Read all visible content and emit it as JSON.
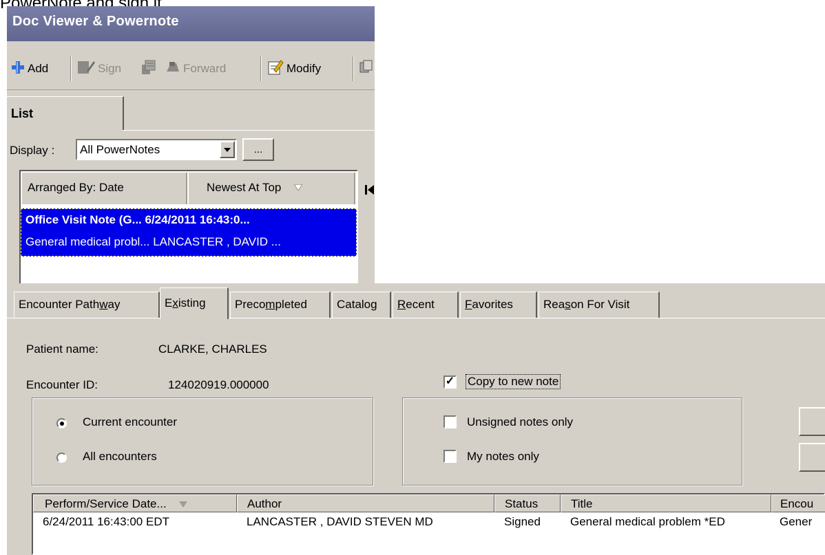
{
  "caption": "PowerNote and sign it.",
  "panel": {
    "title": "Doc Viewer & Powernote"
  },
  "toolbar": {
    "add": "Add",
    "sign": "Sign",
    "forward": "Forward",
    "modify": "Modify"
  },
  "list": {
    "tab_label": "List",
    "display_label": "Display :",
    "display_value": "All PowerNotes",
    "ellipsis": "...",
    "header_arranged": "Arranged By: Date",
    "header_order": "Newest At Top",
    "row_line1": "Office Visit Note (G...  6/24/2011 16:43:0...",
    "row_line2": "General medical probl... LANCASTER , DAVID ..."
  },
  "tabs": [
    {
      "label_pre": "Encounter Path",
      "key": "w",
      "label_post": "ay"
    },
    {
      "label_pre": "E",
      "key": "x",
      "label_post": "isting"
    },
    {
      "label_pre": "Preco",
      "key": "m",
      "label_post": "pleted"
    },
    {
      "label_pre": "Catalo",
      "key": "g",
      "label_post": ""
    },
    {
      "label_pre": "",
      "key": "R",
      "label_post": "ecent"
    },
    {
      "label_pre": "",
      "key": "F",
      "label_post": "avorites"
    },
    {
      "label_pre": "Rea",
      "key": "s",
      "label_post": "on For Visit"
    }
  ],
  "existing": {
    "patient_label": "Patient name:",
    "patient_value": "CLARKE, CHARLES",
    "encounter_label": "Encounter ID:",
    "encounter_value": "124020919.000000",
    "copy_to_new_note": "Copy to new note",
    "copy_checked": true,
    "current_encounter": "Current encounter",
    "all_encounters": "All encounters",
    "unsigned_only": "Unsigned notes only",
    "my_notes_only": "My notes only"
  },
  "notes_table": {
    "columns": [
      "Perform/Service Date...",
      "Author",
      "Status",
      "Title",
      "Encou"
    ],
    "rows": [
      [
        "6/24/2011 16:43:00 EDT",
        "LANCASTER , DAVID STEVEN MD",
        "Signed",
        "General medical problem *ED",
        "Gener"
      ]
    ]
  },
  "icons": [
    "plus-icon",
    "sign-icon",
    "document-stack-icon",
    "forward-icon",
    "modify-icon",
    "first-page-icon"
  ]
}
